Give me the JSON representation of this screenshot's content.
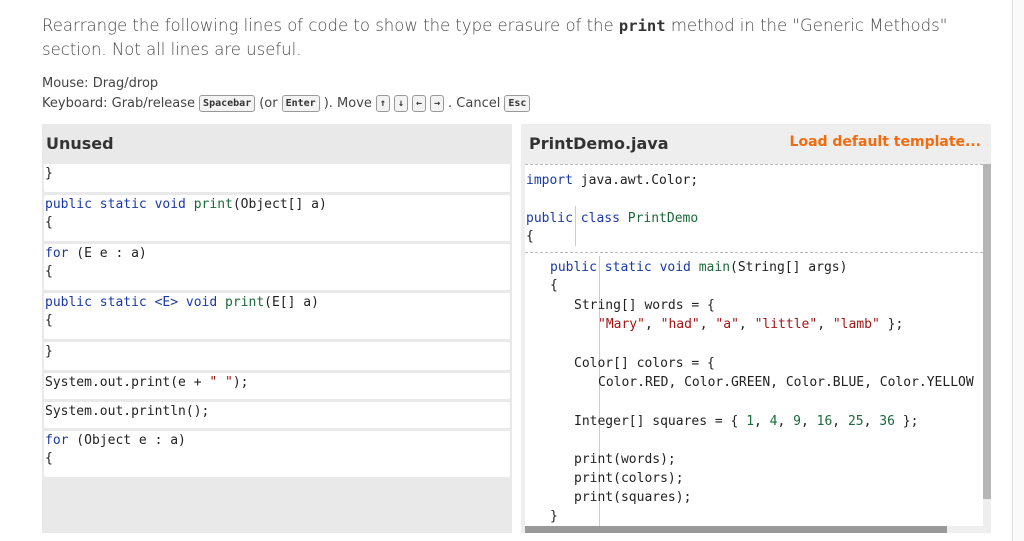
{
  "prompt": {
    "before": "Rearrange the following lines of code to show the type erasure of the ",
    "code": "print",
    "after": " method in the \"Generic Methods\" section. Not all lines are useful."
  },
  "help": {
    "mouse": "Mouse: Drag/drop",
    "kbd_prefix": "Keyboard: Grab/release",
    "key_spacebar": "Spacebar",
    "or_open": "(or",
    "key_enter": "Enter",
    "move_text": "). Move",
    "key_up": "↑",
    "key_down": "↓",
    "key_left": "←",
    "key_right": "→",
    "cancel_text": ". Cancel",
    "key_esc": "Esc"
  },
  "unused": {
    "title": "Unused",
    "blocks": [
      [
        "}"
      ],
      [
        "public static void print(Object[] a)",
        "{"
      ],
      [
        "for (E e : a)",
        "{"
      ],
      [
        "public static <E> void print(E[] a)",
        "{"
      ],
      [
        "}"
      ],
      [
        "System.out.print(e + \" \");"
      ],
      [
        "System.out.println();"
      ],
      [
        "for (Object e : a)",
        "{"
      ]
    ]
  },
  "editor": {
    "file_name": "PrintDemo.java",
    "load_template": "Load default template...",
    "lines": {
      "import": "import java.awt.Color;",
      "class_decl": "public class PrintDemo",
      "open1": "{",
      "main_decl": "public static void main(String[] args)",
      "open2": "{",
      "words_decl": "String[] words = {",
      "words_vals": "\"Mary\", \"had\", \"a\", \"little\", \"lamb\" };",
      "colors_decl": "Color[] colors = {",
      "colors_vals": "Color.RED, Color.GREEN, Color.BLUE, Color.YELLOW",
      "squares": "Integer[] squares = { 1, 4, 9, 16, 25, 36 };",
      "print1": "print(words);",
      "print2": "print(colors);",
      "print3": "print(squares);",
      "close2": "}"
    }
  }
}
